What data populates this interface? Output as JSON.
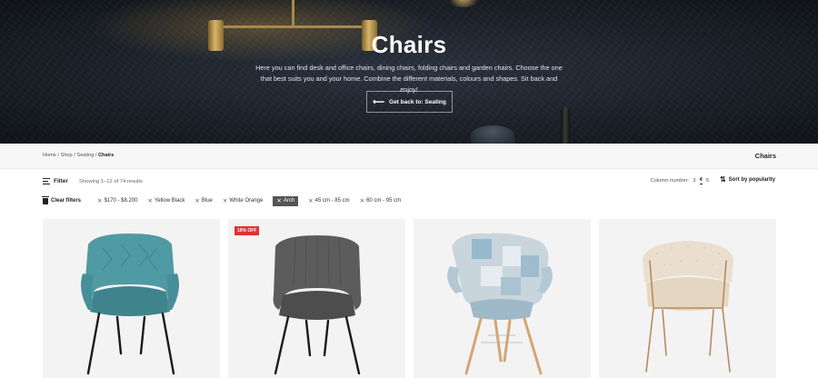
{
  "hero": {
    "title": "Chairs",
    "description": "Here you can find desk and office chairs, dining chairs, folding chairs and garden chairs. Choose the one that best suits you and your home. Combine the different materials, colours and shapes. Sit back and enjoy!",
    "back_button": "Get back to: Seating"
  },
  "breadcrumb": {
    "items": [
      "Home",
      "Shop",
      "Seating"
    ],
    "current": "Chairs",
    "separator": " / "
  },
  "page_title": "Chairs",
  "toolbar": {
    "filter_label": "Filter",
    "showing": "Showing 1–12 of 74 results",
    "column_label": "Column number:",
    "column_options": [
      "3",
      "4",
      "5"
    ],
    "column_selected": "4",
    "sort_label": "Sort by popularity"
  },
  "filters": {
    "clear_label": "Clear filters",
    "chips": [
      {
        "label": "$170 - $8.200",
        "active": false
      },
      {
        "label": "Yellow Black",
        "active": false
      },
      {
        "label": "Blue",
        "active": false
      },
      {
        "label": "White Orange",
        "active": false
      },
      {
        "label": "Arch",
        "active": true
      },
      {
        "label": "45 cm - 85 cm",
        "active": false
      },
      {
        "label": "60 cm - 95 cm",
        "active": false
      }
    ]
  },
  "products": [
    {
      "badge": "",
      "color": "#4f9aa3",
      "legs": "#1a1a1a"
    },
    {
      "badge": "10% OFF",
      "color": "#5c5c5c",
      "legs": "#1a1a1a"
    },
    {
      "badge": "",
      "color": "#b8c9d4",
      "legs": "#d4a572"
    },
    {
      "badge": "",
      "color": "#e8dfd0",
      "legs": "#b88a5a"
    }
  ],
  "colors": {
    "badge_red": "#e03131",
    "chip_active_bg": "#555555"
  }
}
